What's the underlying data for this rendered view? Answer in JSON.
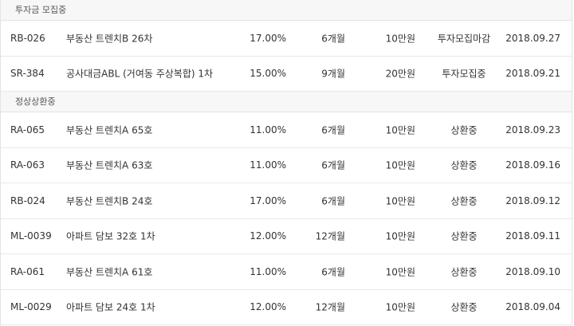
{
  "sections": [
    {
      "title": "투자금 모집중",
      "rows": [
        {
          "code": "RB-026",
          "name": "부동산 트렌치B 26차",
          "rate": "17.00%",
          "term": "6개월",
          "amount": "10만원",
          "status": "투자모집마감",
          "date": "2018.09.27"
        },
        {
          "code": "SR-384",
          "name": "공사대금ABL (거여동 주상복합) 1차",
          "rate": "15.00%",
          "term": "9개월",
          "amount": "20만원",
          "status": "투자모집중",
          "date": "2018.09.21"
        }
      ]
    },
    {
      "title": "정상상환중",
      "rows": [
        {
          "code": "RA-065",
          "name": "부동산 트렌치A 65호",
          "rate": "11.00%",
          "term": "6개월",
          "amount": "10만원",
          "status": "상환중",
          "date": "2018.09.23"
        },
        {
          "code": "RA-063",
          "name": "부동산 트렌치A 63호",
          "rate": "11.00%",
          "term": "6개월",
          "amount": "10만원",
          "status": "상환중",
          "date": "2018.09.16"
        },
        {
          "code": "RB-024",
          "name": "부동산 트렌치B 24호",
          "rate": "17.00%",
          "term": "6개월",
          "amount": "10만원",
          "status": "상환중",
          "date": "2018.09.12"
        },
        {
          "code": "ML-0039",
          "name": "아파트 담보 32호 1차",
          "rate": "12.00%",
          "term": "12개월",
          "amount": "10만원",
          "status": "상환중",
          "date": "2018.09.11"
        },
        {
          "code": "RA-061",
          "name": "부동산 트렌치A 61호",
          "rate": "11.00%",
          "term": "6개월",
          "amount": "10만원",
          "status": "상환중",
          "date": "2018.09.10"
        },
        {
          "code": "ML-0029",
          "name": "아파트 담보 24호 1차",
          "rate": "12.00%",
          "term": "12개월",
          "amount": "10만원",
          "status": "상환중",
          "date": "2018.09.04"
        }
      ]
    }
  ]
}
